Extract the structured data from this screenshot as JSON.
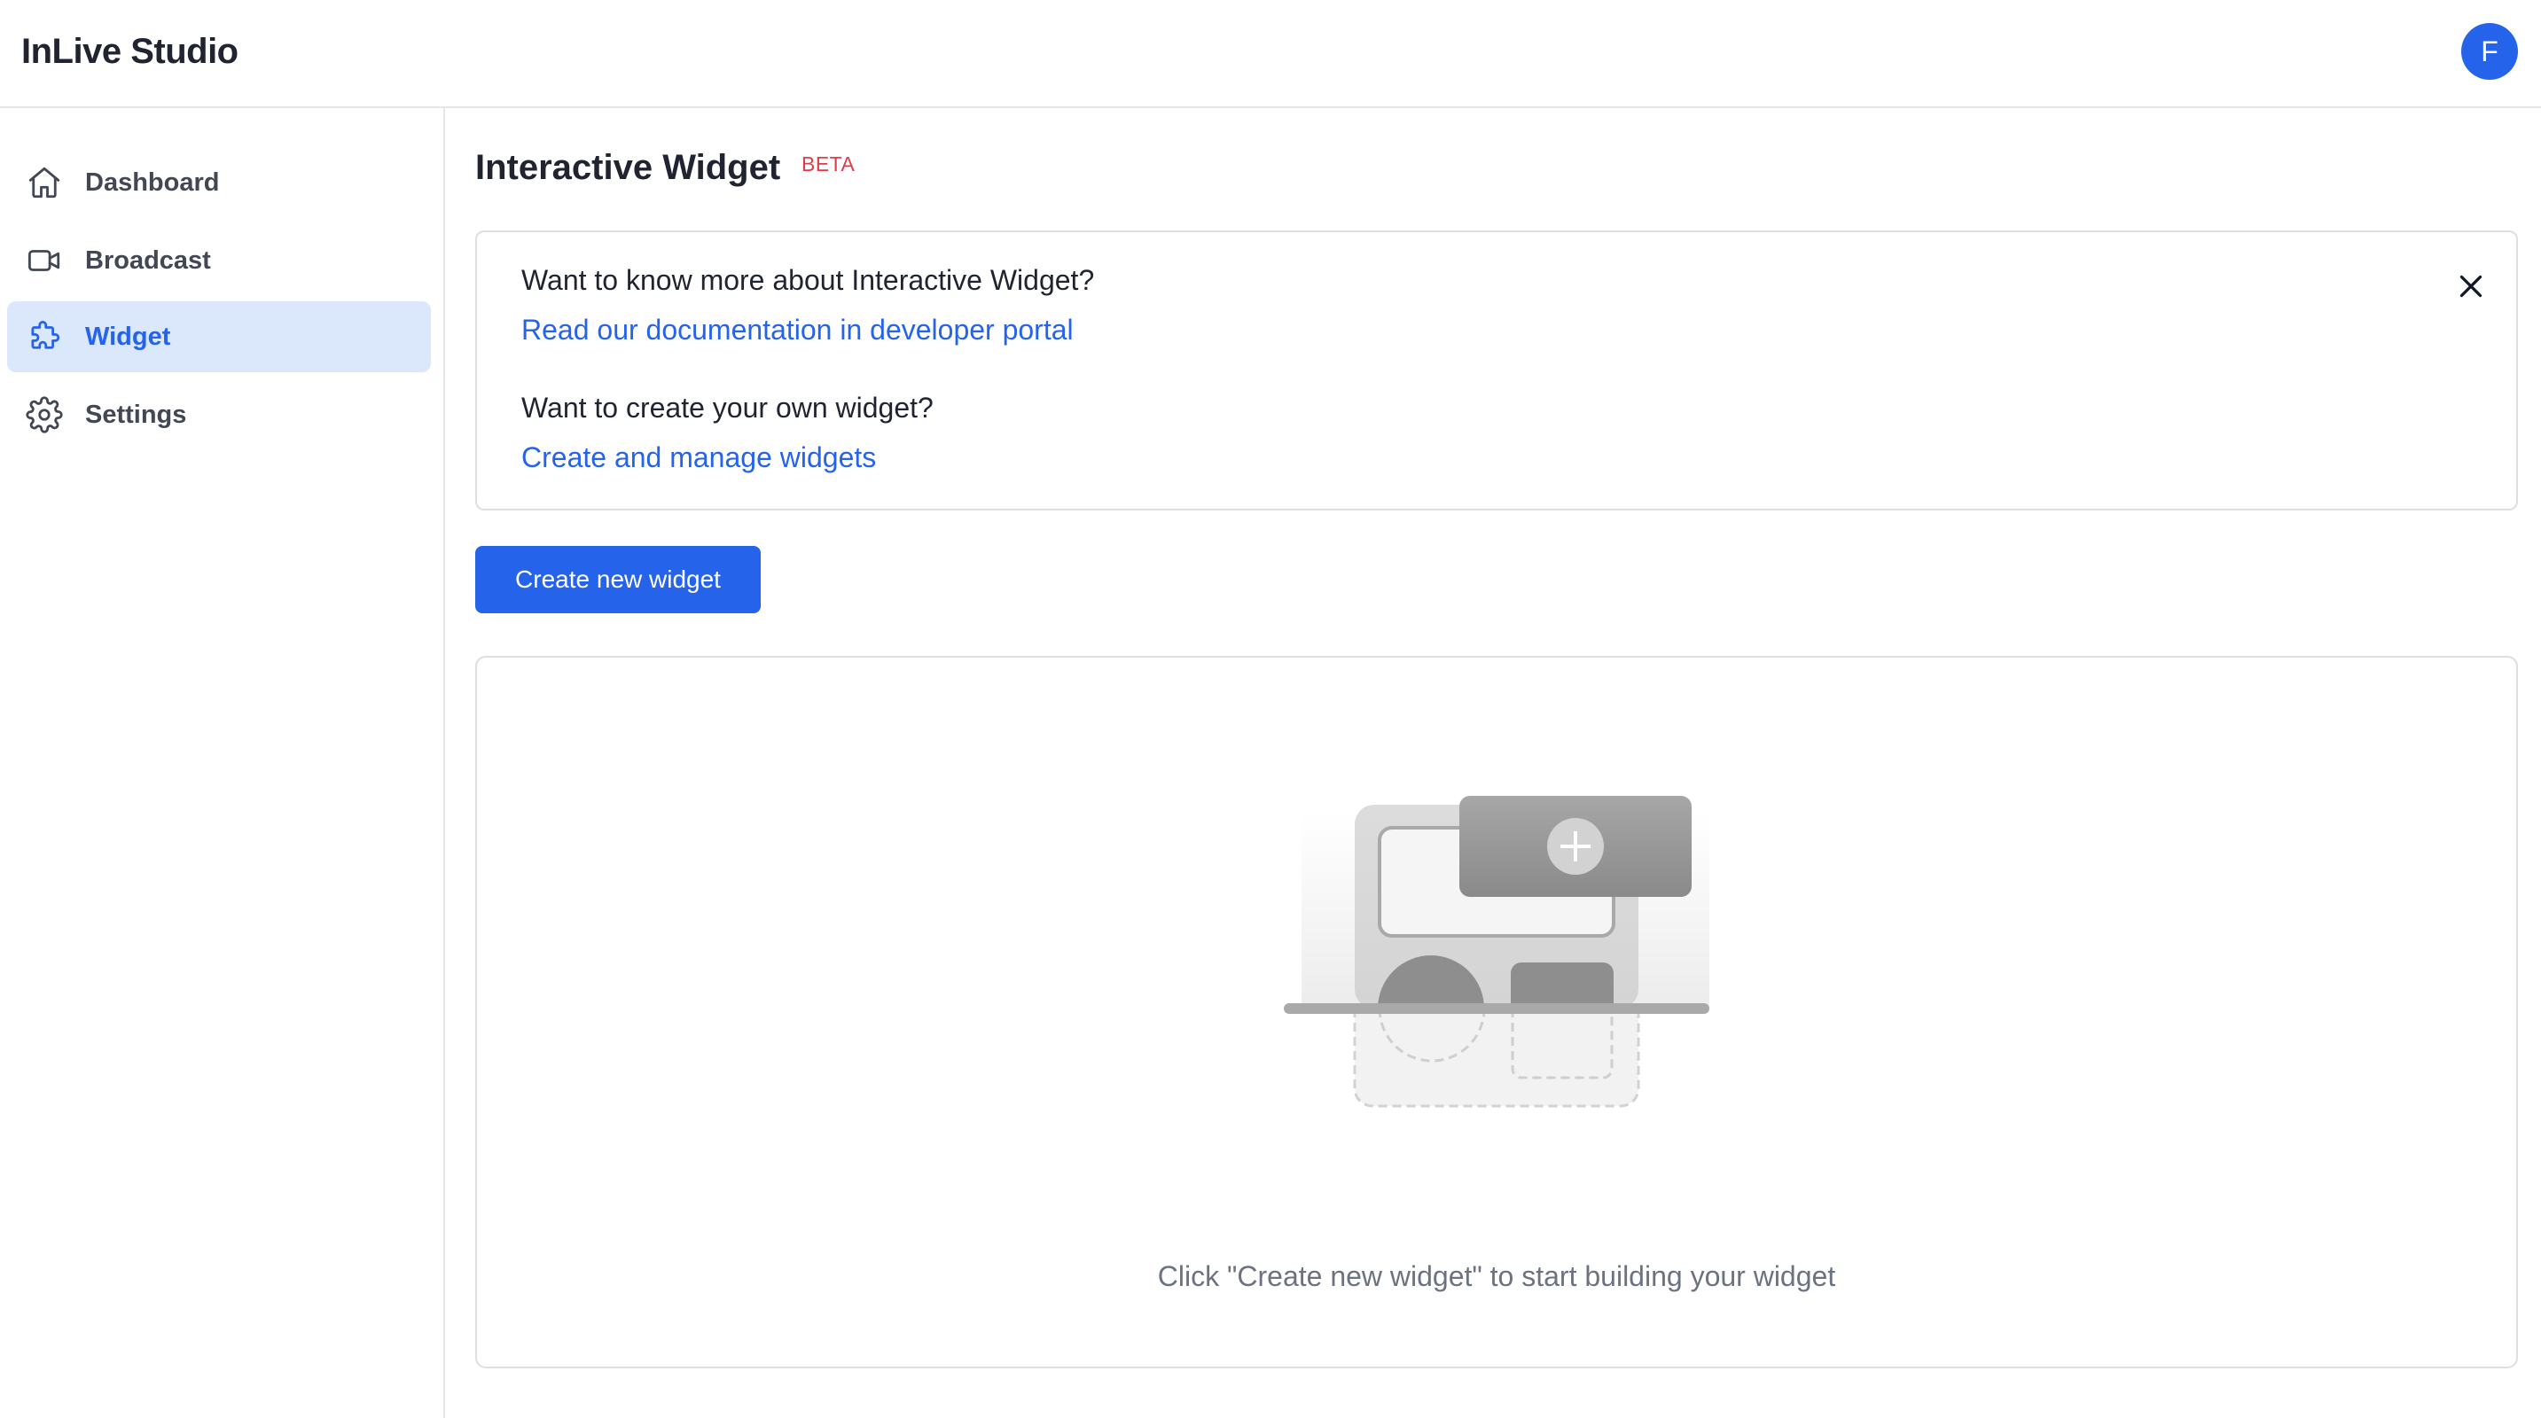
{
  "app": {
    "title": "InLive Studio",
    "avatar_initial": "F"
  },
  "sidebar": {
    "items": [
      {
        "label": "Dashboard",
        "icon": "home-icon",
        "active": false
      },
      {
        "label": "Broadcast",
        "icon": "video-camera-icon",
        "active": false
      },
      {
        "label": "Widget",
        "icon": "puzzle-icon",
        "active": true
      },
      {
        "label": "Settings",
        "icon": "gear-icon",
        "active": false
      }
    ]
  },
  "main": {
    "title": "Interactive Widget",
    "badge": "BETA",
    "info": {
      "question1": "Want to know more about Interactive Widget?",
      "link1": "Read our documentation in developer portal",
      "question2": "Want to create your own widget?",
      "link2": "Create and manage widgets"
    },
    "create_button": "Create new widget",
    "empty_state": {
      "text": "Click \"Create new widget\" to start building your widget"
    }
  },
  "colors": {
    "accent": "#2563eb",
    "active_bg": "#dbe8fb",
    "beta": "#e53946",
    "border": "#dcdfe3"
  }
}
